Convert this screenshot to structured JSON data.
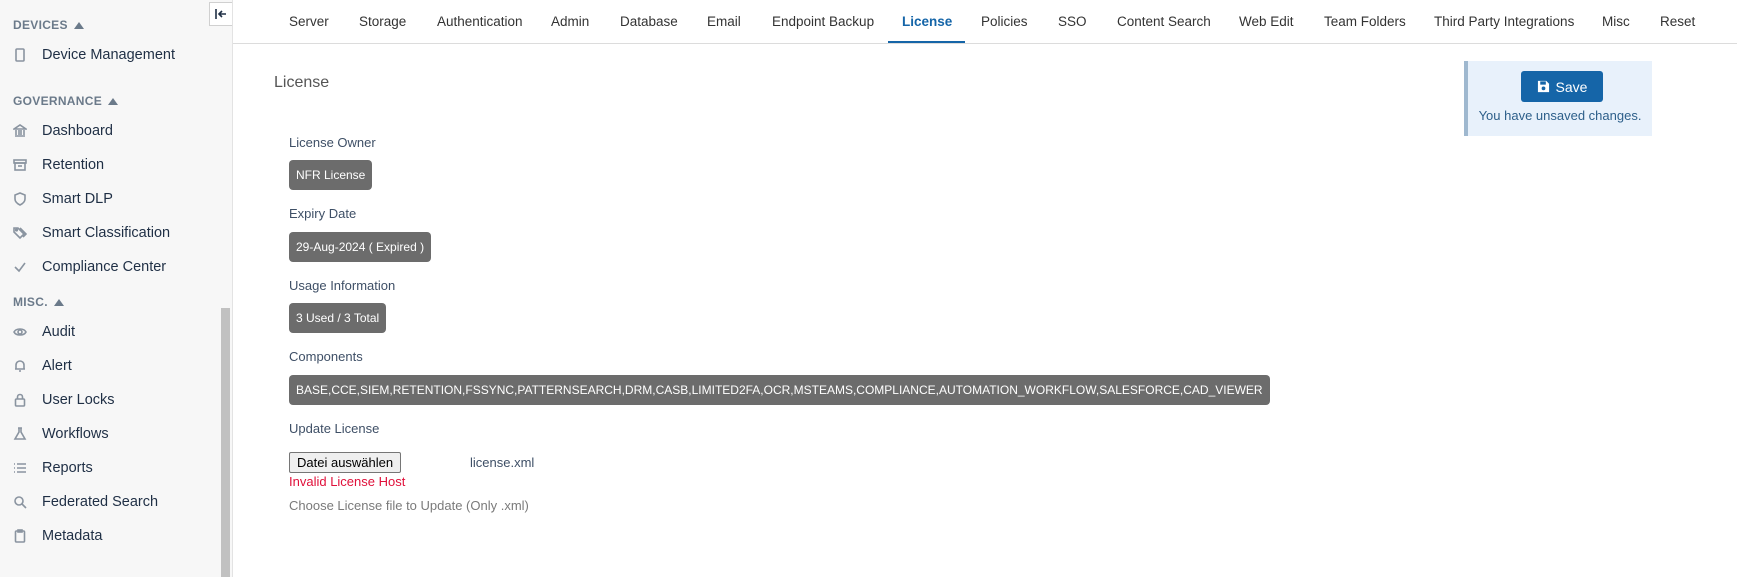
{
  "sidebar": {
    "sections": [
      {
        "title": "DEVICES",
        "items": [
          {
            "label": "Device Management",
            "icon": "tablet-icon"
          }
        ]
      },
      {
        "title": "GOVERNANCE",
        "items": [
          {
            "label": "Dashboard",
            "icon": "bank-icon"
          },
          {
            "label": "Retention",
            "icon": "archive-icon"
          },
          {
            "label": "Smart DLP",
            "icon": "shield-icon"
          },
          {
            "label": "Smart Classification",
            "icon": "tags-icon"
          },
          {
            "label": "Compliance Center",
            "icon": "check-icon"
          }
        ]
      },
      {
        "title": "MISC.",
        "items": [
          {
            "label": "Audit",
            "icon": "eye-icon"
          },
          {
            "label": "Alert",
            "icon": "bell-icon"
          },
          {
            "label": "User Locks",
            "icon": "lock-icon"
          },
          {
            "label": "Workflows",
            "icon": "flask-icon"
          },
          {
            "label": "Reports",
            "icon": "list-icon"
          },
          {
            "label": "Federated Search",
            "icon": "search-icon"
          },
          {
            "label": "Metadata",
            "icon": "clipboard-icon"
          }
        ]
      }
    ]
  },
  "tabs": [
    "Server",
    "Storage",
    "Authentication",
    "Admin",
    "Database",
    "Email",
    "Endpoint Backup",
    "License",
    "Policies",
    "SSO",
    "Content Search",
    "Web Edit",
    "Team Folders",
    "Third Party Integrations",
    "Misc",
    "Reset"
  ],
  "active_tab": "License",
  "page": {
    "title": "License",
    "license_owner_label": "License Owner",
    "license_owner": "NFR License",
    "expiry_label": "Expiry Date",
    "expiry": "29-Aug-2024 ( Expired )",
    "usage_label": "Usage Information",
    "usage": "3 Used / 3 Total",
    "components_label": "Components",
    "components": "BASE,CCE,SIEM,RETENTION,FSSYNC,PATTERNSEARCH,DRM,CASB,LIMITED2FA,OCR,MSTEAMS,COMPLIANCE,AUTOMATION_WORKFLOW,SALESFORCE,CAD_VIEWER",
    "update_label": "Update License",
    "file_button": "Datei auswählen",
    "file_name": "license.xml",
    "error": "Invalid License Host",
    "hint": "Choose License file to Update (Only .xml)"
  },
  "save_panel": {
    "button": "Save",
    "message": "You have unsaved changes."
  },
  "colors": {
    "accent": "#1565a8",
    "pill": "#6c6c6c",
    "error": "#e0103a"
  }
}
